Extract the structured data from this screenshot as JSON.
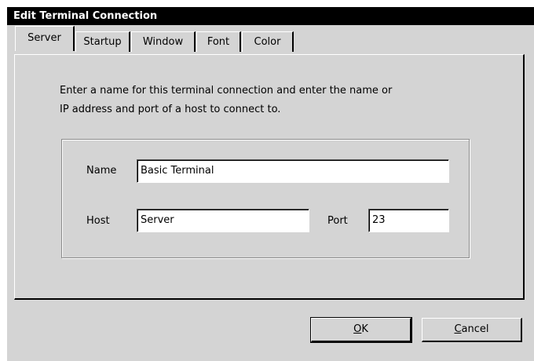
{
  "window": {
    "title": "Edit Terminal Connection"
  },
  "tabs": [
    {
      "label": "Server",
      "active": true
    },
    {
      "label": "Startup",
      "active": false
    },
    {
      "label": "Window",
      "active": false
    },
    {
      "label": "Font",
      "active": false
    },
    {
      "label": "Color",
      "active": false
    }
  ],
  "server_tab": {
    "intro_line1": "Enter a name for this terminal connection and enter the name or",
    "intro_line2": "IP address and port of a host to connect to.",
    "name_label": "Name",
    "name_value": "Basic Terminal",
    "host_label": "Host",
    "host_value": "Server",
    "port_label": "Port",
    "port_value": "23"
  },
  "buttons": {
    "ok_mnemonic": "O",
    "ok_rest": "K",
    "cancel_mnemonic": "C",
    "cancel_rest": "ancel"
  }
}
